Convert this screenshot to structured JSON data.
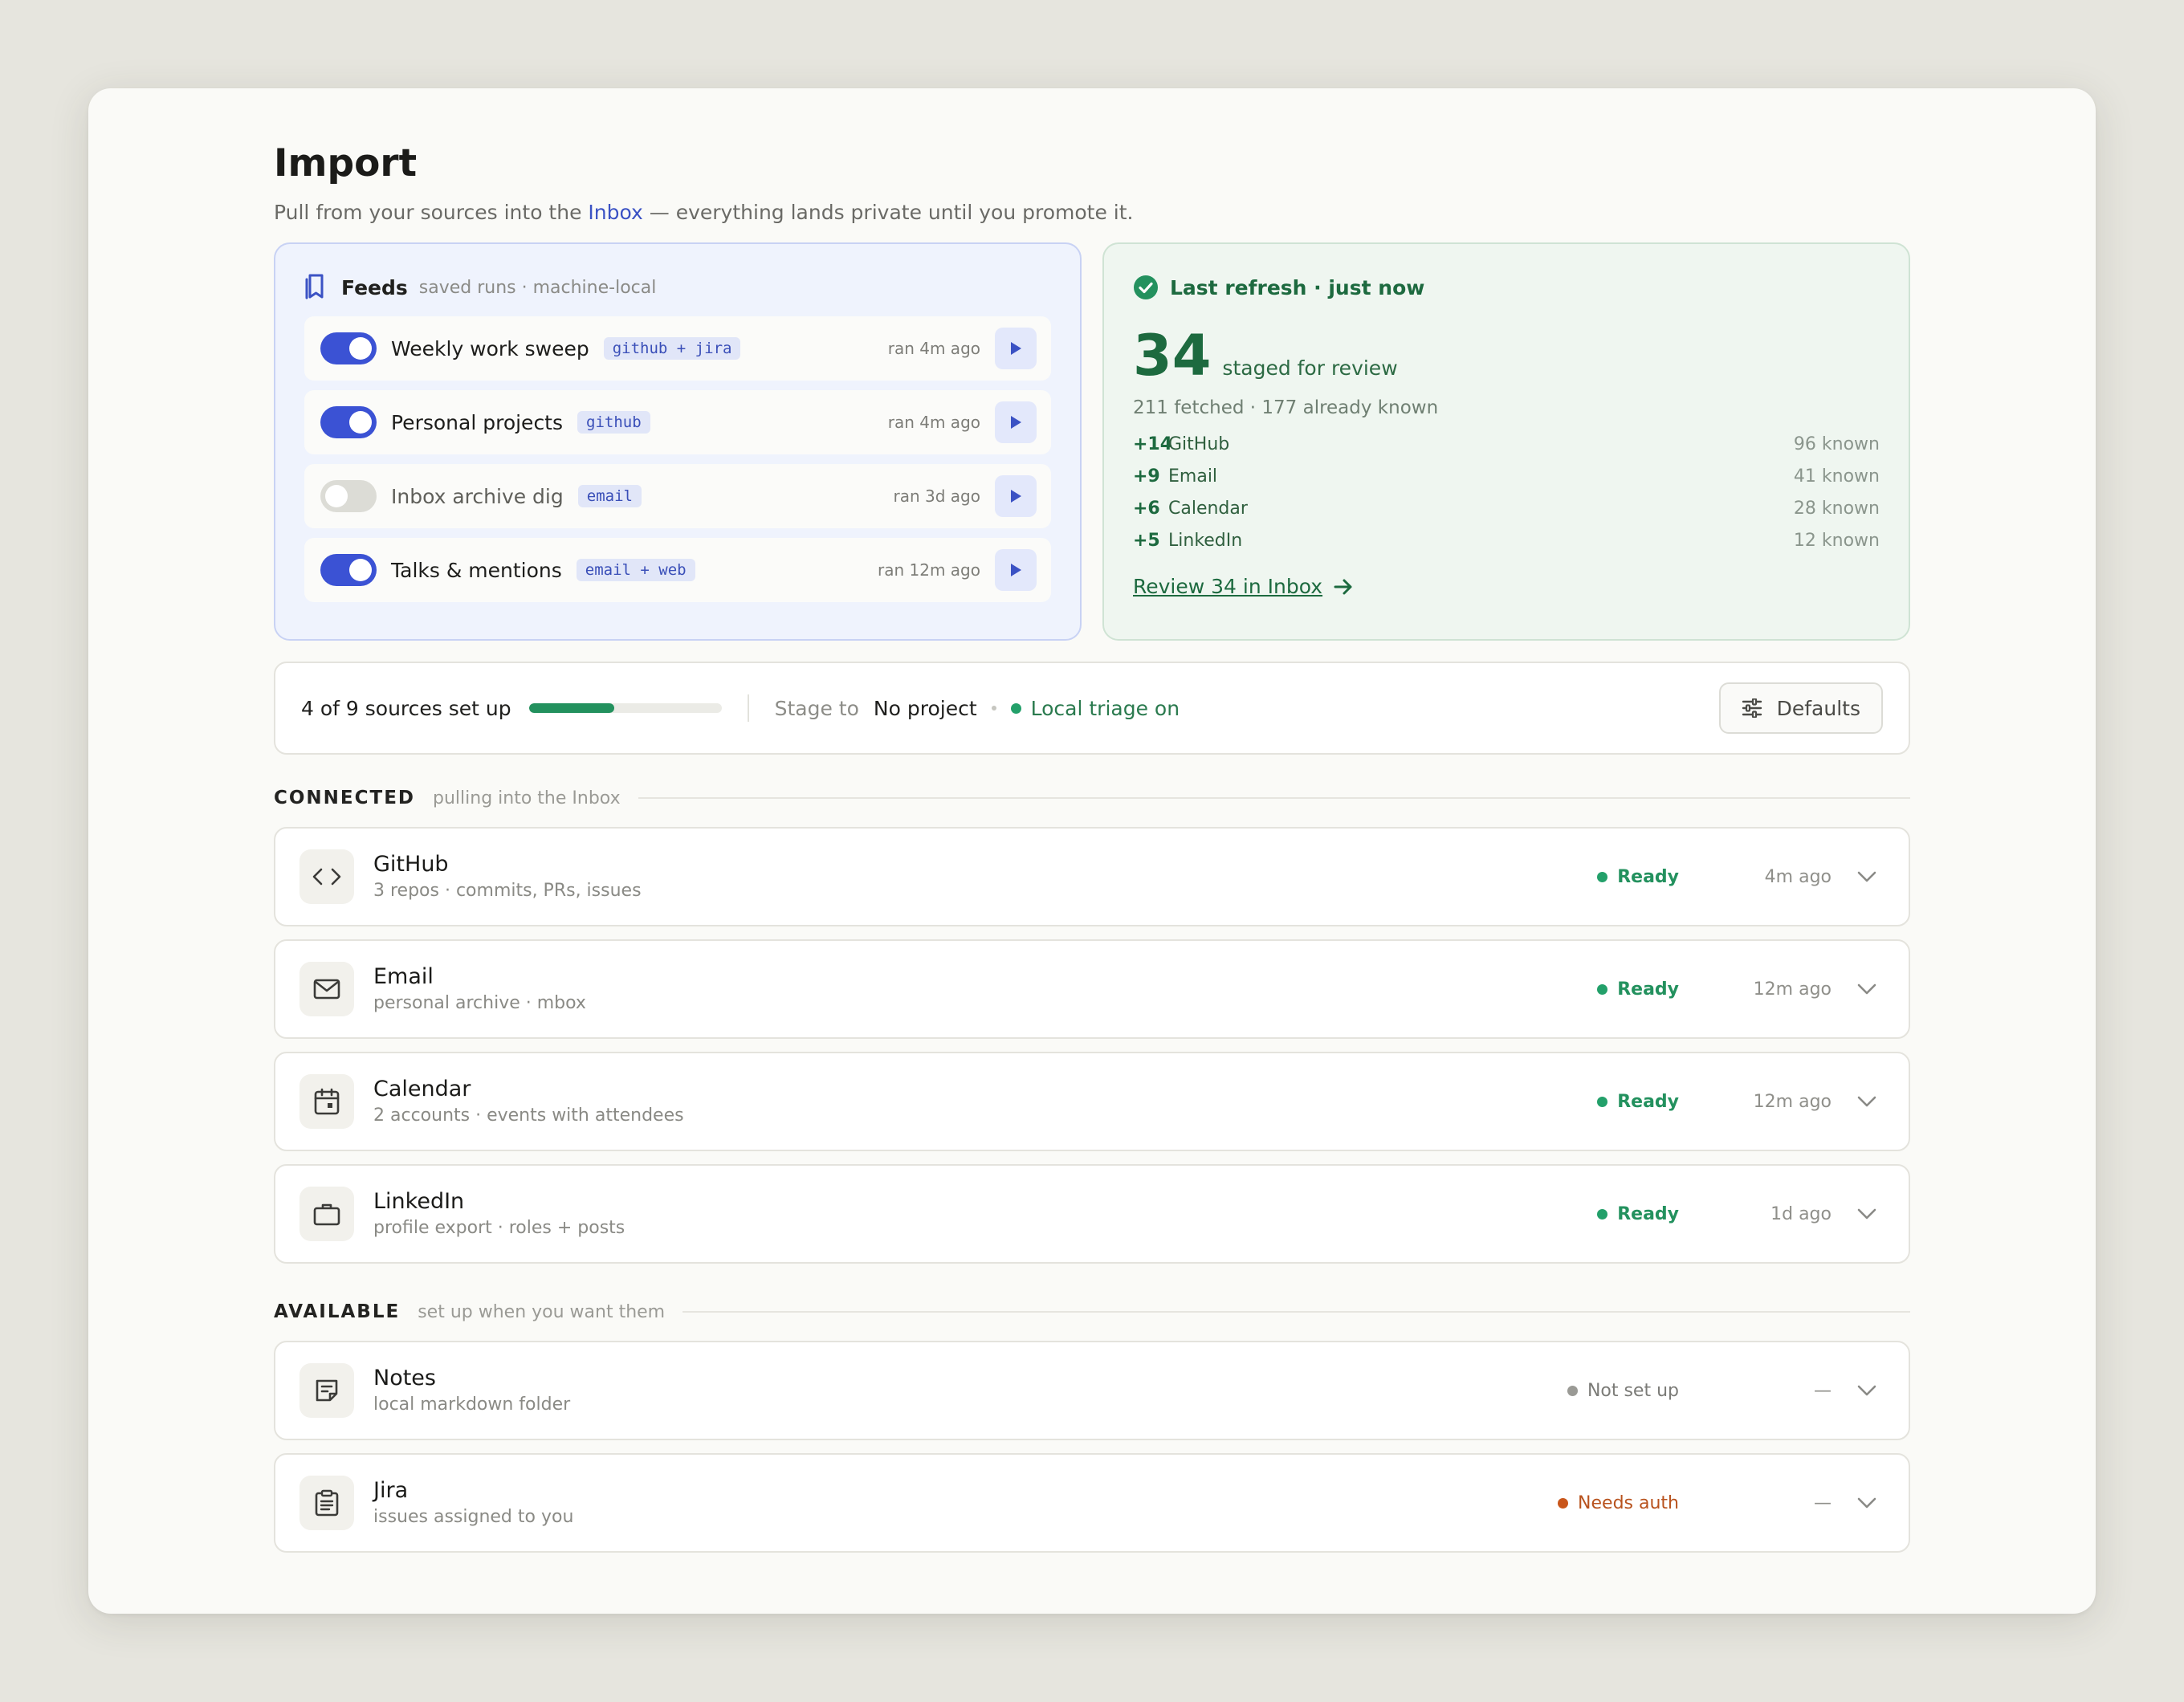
{
  "header": {
    "title": "Import",
    "subtitle_before": "Pull from your sources into the ",
    "subtitle_link": "Inbox",
    "subtitle_after": " — everything lands private until you promote it."
  },
  "feeds": {
    "title": "Feeds",
    "meta": "saved runs · machine-local",
    "items": [
      {
        "name": "Weekly work sweep",
        "tag": "github + jira",
        "ran": "ran 4m ago",
        "enabled": true
      },
      {
        "name": "Personal projects",
        "tag": "github",
        "ran": "ran 4m ago",
        "enabled": true
      },
      {
        "name": "Inbox archive dig",
        "tag": "email",
        "ran": "ran 3d ago",
        "enabled": false
      },
      {
        "name": "Talks & mentions",
        "tag": "email + web",
        "ran": "ran 12m ago",
        "enabled": true
      }
    ]
  },
  "refresh": {
    "title": "Last refresh · just now",
    "staged_count": "34",
    "staged_label": "staged for review",
    "fetched_line": "211 fetched · 177 already known",
    "sources": [
      {
        "plus": "+14",
        "name": "GitHub",
        "known": "96 known"
      },
      {
        "plus": "+9",
        "name": "Email",
        "known": "41 known"
      },
      {
        "plus": "+6",
        "name": "Calendar",
        "known": "28 known"
      },
      {
        "plus": "+5",
        "name": "LinkedIn",
        "known": "12 known"
      }
    ],
    "review_link": "Review 34 in Inbox"
  },
  "status": {
    "sources_text": "4 of 9 sources set up",
    "progress_fraction": 0.444,
    "stage_label": "Stage to",
    "stage_value": "No project",
    "triage": "Local triage on",
    "defaults_label": "Defaults"
  },
  "connected": {
    "label": "CONNECTED",
    "hint": "pulling into the Inbox",
    "items": [
      {
        "name": "GitHub",
        "desc": "3 repos · commits, PRs, issues",
        "status": "Ready",
        "time": "4m ago",
        "icon": "code-icon"
      },
      {
        "name": "Email",
        "desc": "personal archive · mbox",
        "status": "Ready",
        "time": "12m ago",
        "icon": "mail-icon"
      },
      {
        "name": "Calendar",
        "desc": "2 accounts · events with attendees",
        "status": "Ready",
        "time": "12m ago",
        "icon": "calendar-icon"
      },
      {
        "name": "LinkedIn",
        "desc": "profile export · roles + posts",
        "status": "Ready",
        "time": "1d ago",
        "icon": "briefcase-icon"
      }
    ]
  },
  "available": {
    "label": "AVAILABLE",
    "hint": "set up when you want them",
    "items": [
      {
        "name": "Notes",
        "desc": "local markdown folder",
        "status": "Not set up",
        "time": "—",
        "icon": "note-icon"
      },
      {
        "name": "Jira",
        "desc": "issues assigned to you",
        "status": "Needs auth",
        "time": "—",
        "icon": "clipboard-icon"
      }
    ]
  },
  "colors": {
    "accent_blue": "#3b52d4",
    "accent_green": "#1d6a3f",
    "status_ready": "#23a06a",
    "status_auth": "#c9561b"
  }
}
